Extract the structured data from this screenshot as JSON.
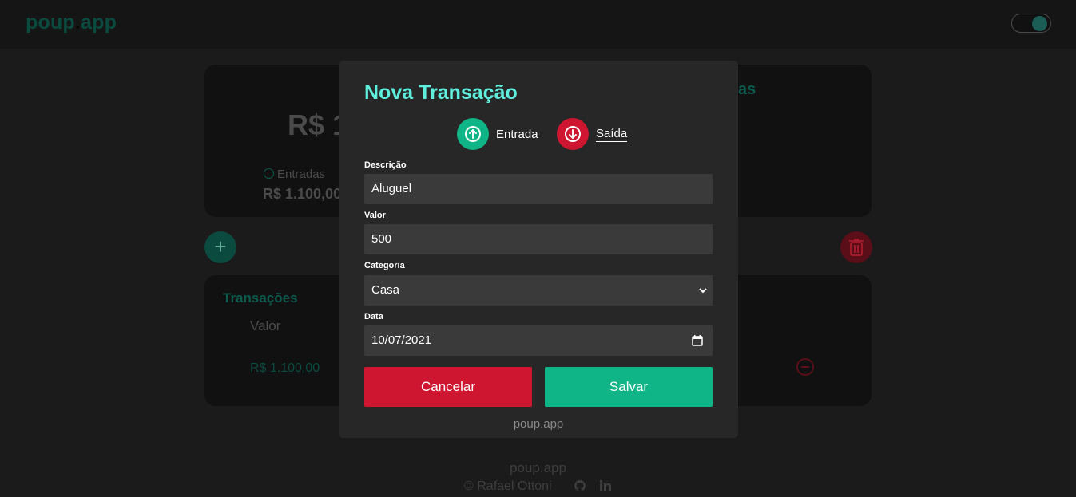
{
  "header": {
    "logo_main": "poup",
    "logo_dot": ".",
    "logo_tail": "app"
  },
  "summary": {
    "balance": "R$ 1",
    "entradas_label": "Entradas",
    "entradas_value": "R$ 1.100,00",
    "right_heading": "as"
  },
  "transactions": {
    "title": "Transações",
    "column_valor": "Valor",
    "row_valor": "R$ 1.100,00"
  },
  "modal": {
    "title": "Nova Transação",
    "type_in_label": "Entrada",
    "type_out_label": "Saída",
    "descricao_label": "Descrição",
    "descricao_value": "Aluguel",
    "valor_label": "Valor",
    "valor_value": "500",
    "categoria_label": "Categoria",
    "categoria_value": "Casa",
    "data_label": "Data",
    "data_value": "10/07/2021",
    "cancel_label": "Cancelar",
    "save_label": "Salvar",
    "footer": "poup.app"
  },
  "footer": {
    "brand": "poup.app",
    "author": "© Rafael Ottoni"
  },
  "colors": {
    "accent": "#5fefdd",
    "income": "#0fb586",
    "expense": "#cf1631"
  },
  "icons": [
    "arrow-up-icon",
    "arrow-down-icon",
    "plus-icon",
    "trash-icon",
    "minus-circle-icon",
    "github-icon",
    "linkedin-icon",
    "chevron-down-icon",
    "calendar-icon"
  ]
}
